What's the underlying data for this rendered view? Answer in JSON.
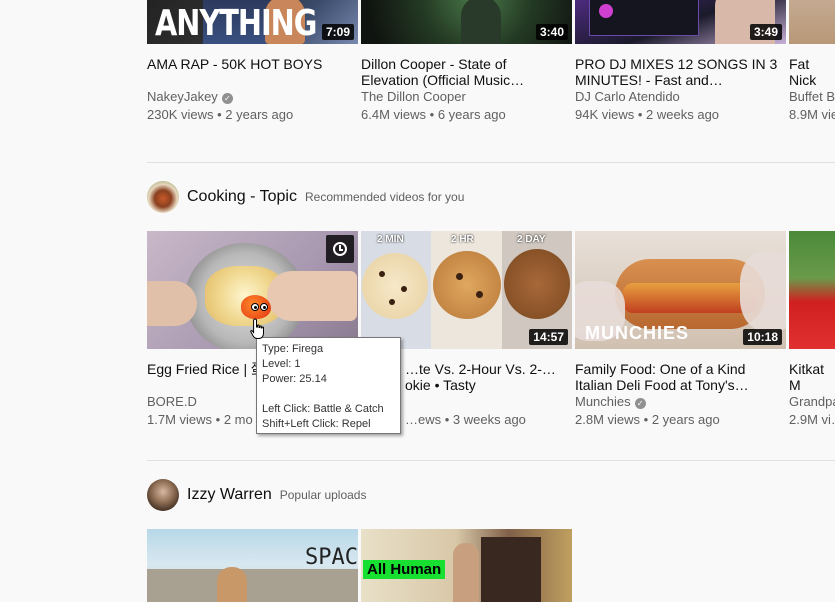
{
  "row1": [
    {
      "title": "AMA RAP - 50K HOT BOYS",
      "thumb_text": "ANYTHING",
      "duration": "7:09",
      "channel": "NakeyJakey",
      "verified": true,
      "views": "230K views",
      "age": "2 years ago"
    },
    {
      "title": "Dillon Cooper - State of Elevation (Official Music…",
      "duration": "3:40",
      "channel": "The Dillon Cooper",
      "verified": false,
      "views": "6.4M views",
      "age": "6 years ago"
    },
    {
      "title": "PRO DJ MIXES 12 SONGS IN 3 MINUTES! - Fast and…",
      "duration": "3:49",
      "channel": "DJ Carlo Atendido",
      "verified": false,
      "views": "94K views",
      "age": "2 weeks ago"
    },
    {
      "title": "Fat Nick (Officia…",
      "channel": "Buffet B…",
      "views": "8.9M vie…"
    }
  ],
  "shelf_cooking": {
    "title": "Cooking - Topic",
    "subtitle": "Recommended videos for you"
  },
  "row2": [
    {
      "title": "Egg Fried Rice | 蛋",
      "channel": "BORE.D",
      "views": "1.7M views",
      "age": "2 mo"
    },
    {
      "title": "…te Vs. 2-Hour Vs. 2-…okie • Tasty",
      "thumb_labels": [
        "2 MIN",
        "2 HR",
        "2 DAY"
      ],
      "duration": "14:57",
      "views": "…ews",
      "age": "3 weeks ago"
    },
    {
      "title": "Family Food: One of a Kind Italian Deli Food at Tony's…",
      "thumb_text": "MUNCHIES",
      "duration": "10:18",
      "channel": "Munchies",
      "verified": true,
      "views": "2.8M views",
      "age": "2 years ago"
    },
    {
      "title": "Kitkat M DESSER…",
      "channel": "Grandpa…",
      "views": "2.9M vi…"
    }
  ],
  "shelf_izzy": {
    "title": "Izzy Warren",
    "subtitle": "Popular uploads"
  },
  "row3": [
    {
      "thumb_text": "SPACE"
    },
    {
      "thumb_text": "All Human"
    }
  ],
  "tooltip": {
    "type": "Type: Firega",
    "level": "Level: 1",
    "power": "Power: 25.14",
    "left_click": "Left Click: Battle & Catch",
    "shift_click": "Shift+Left Click: Repel"
  },
  "colors": {
    "bg": "#f9f9f9",
    "meta": "#606060",
    "divider": "#e0e0e0"
  }
}
